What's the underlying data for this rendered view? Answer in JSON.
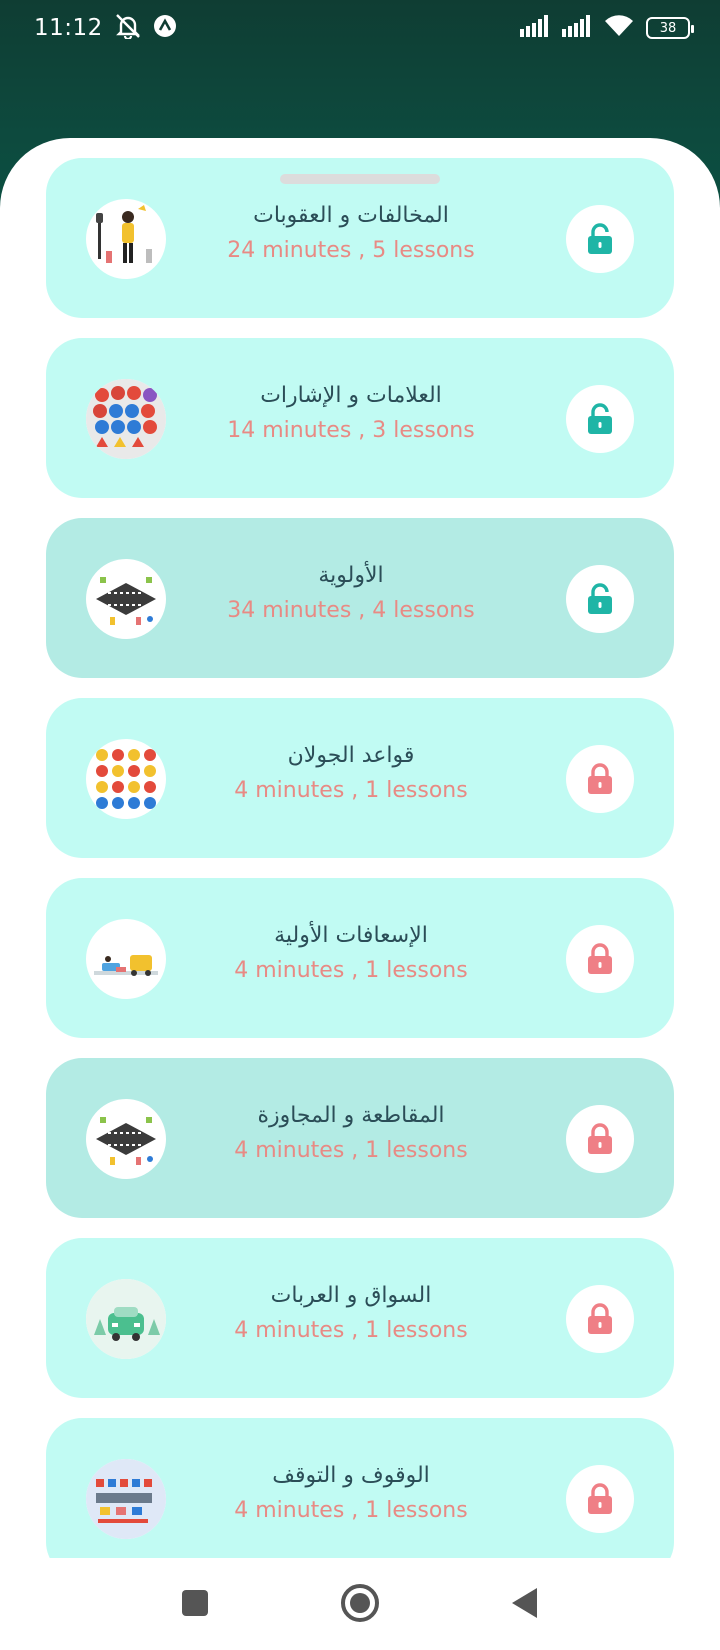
{
  "status_bar": {
    "time": "11:12",
    "battery": "38",
    "icons": [
      "muted-notifications-icon",
      "app-a-icon",
      "signal-icon",
      "signal-icon",
      "wifi-icon",
      "battery-icon"
    ]
  },
  "colors": {
    "header_gradient": [
      "#0f3d33",
      "#0a5646"
    ],
    "card_bg": "#c1fbf3",
    "card_bg_selected": "#b3ebe4",
    "title": "#2b4d57",
    "subtitle": "#e88a84",
    "unlocked": "#1fb5a6",
    "locked": "#ef7f86"
  },
  "lessons": [
    {
      "title": "المخالفات و العقوبات",
      "subtitle": "24 minutes , 5 lessons",
      "locked": false,
      "selected": false,
      "thumb": "traffic-officer-image"
    },
    {
      "title": "العلامات و الإشارات",
      "subtitle": "14 minutes , 3 lessons",
      "locked": false,
      "selected": false,
      "thumb": "road-signs-image"
    },
    {
      "title": "الأولوية",
      "subtitle": "34 minutes , 4 lessons",
      "locked": false,
      "selected": true,
      "thumb": "intersection-image"
    },
    {
      "title": "قواعد الجولان",
      "subtitle": "4 minutes , 1 lessons",
      "locked": true,
      "selected": false,
      "thumb": "road-signs-grid-image"
    },
    {
      "title": "الإسعافات الأولية",
      "subtitle": "4 minutes , 1 lessons",
      "locked": true,
      "selected": false,
      "thumb": "first-aid-image"
    },
    {
      "title": "المقاطعة و المجاوزة",
      "subtitle": "4 minutes , 1 lessons",
      "locked": true,
      "selected": true,
      "thumb": "intersection-image"
    },
    {
      "title": "السواق و العربات",
      "subtitle": "4 minutes , 1 lessons",
      "locked": true,
      "selected": false,
      "thumb": "car-image"
    },
    {
      "title": "الوقوف و التوقف",
      "subtitle": "4 minutes , 1 lessons",
      "locked": true,
      "selected": false,
      "thumb": "parking-image"
    }
  ],
  "nav": [
    "recents-button",
    "home-button",
    "back-button"
  ]
}
